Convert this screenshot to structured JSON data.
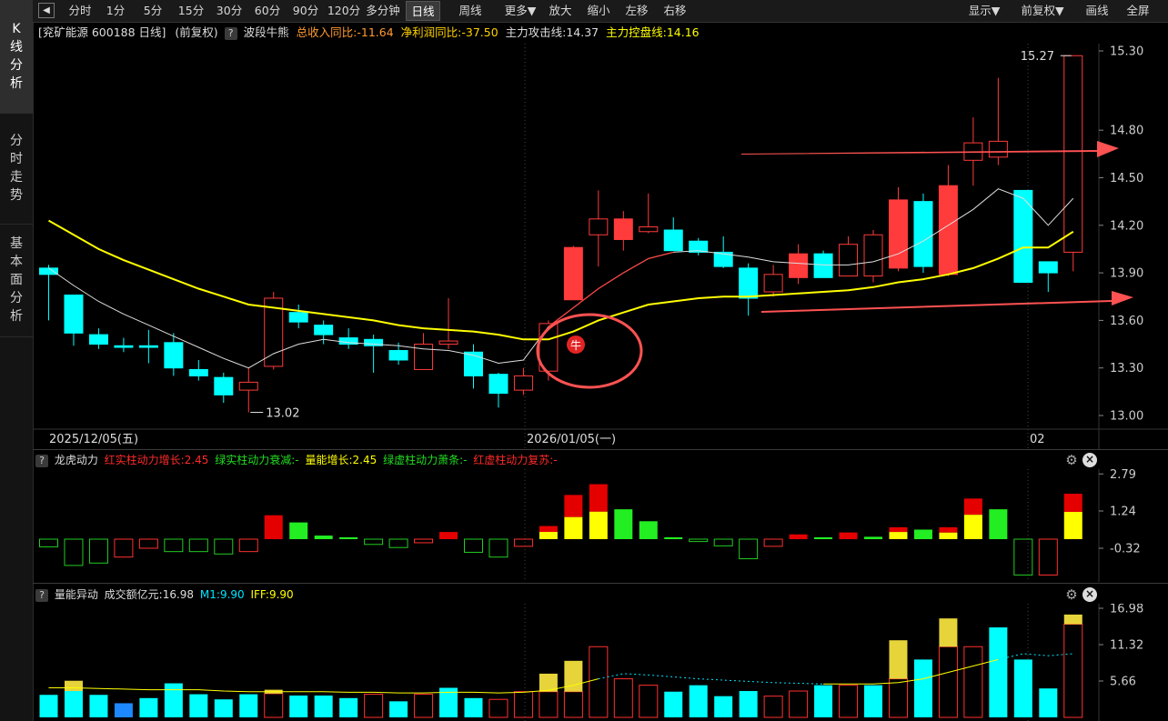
{
  "sidebar": {
    "tabs": [
      {
        "label": "K线分析",
        "active": true
      },
      {
        "label": "分时走势",
        "active": false
      },
      {
        "label": "基本面分析",
        "active": false
      }
    ]
  },
  "toolbar": {
    "back_icon": "triangle-left-icon",
    "left_items": [
      {
        "label": "分时",
        "active": false
      },
      {
        "label": "1分",
        "active": false
      },
      {
        "label": "5分",
        "active": false
      },
      {
        "label": "15分",
        "active": false
      },
      {
        "label": "30分",
        "active": false
      },
      {
        "label": "60分",
        "active": false
      },
      {
        "label": "90分",
        "active": false
      },
      {
        "label": "120分",
        "active": false
      },
      {
        "label": "多分钟",
        "active": false
      },
      {
        "label": "日线",
        "active": true
      },
      {
        "label": "周线",
        "active": false
      },
      {
        "label": "更多▼",
        "active": false
      },
      {
        "label": "放大",
        "active": false
      },
      {
        "label": "缩小",
        "active": false
      },
      {
        "label": "左移",
        "active": false
      },
      {
        "label": "右移",
        "active": false
      }
    ],
    "right_items": [
      {
        "label": "显示▼"
      },
      {
        "label": "前复权▼"
      },
      {
        "label": "画线"
      },
      {
        "label": "全屏"
      }
    ]
  },
  "main_chart": {
    "stock_title": "[兖矿能源 600188 日线]",
    "adjust": "(前复权)",
    "help": "?",
    "indicator_name": "波段牛熊",
    "revenue_yoy": "总收入同比:-11.64",
    "profit_yoy": "净利润同比:-37.50",
    "attack_line": "主力攻击线:14.37",
    "control_line": "主力控盘线:14.16",
    "y_ticks": [
      "15.30",
      "14.80",
      "14.50",
      "14.20",
      "13.90",
      "13.60",
      "13.30",
      "13.00"
    ],
    "x_labels": [
      "2025/12/05(五)",
      "2026/01/05(一)",
      "02"
    ],
    "max_label": "15.27",
    "min_label": "13.02",
    "bull_marker": "牛",
    "colors": {
      "up": "#ff3b3b",
      "down": "#00ffff",
      "ma_yellow": "#ffff00",
      "ma_white": "#dddddd",
      "annotation": "#ff5252"
    }
  },
  "indicator1": {
    "help": "?",
    "name": "龙虎动力",
    "red_solid": "红实柱动力增长:2.45",
    "green_solid": "绿实柱动力衰减:-",
    "volume_growth": "量能增长:2.45",
    "green_hollow": "绿虚柱动力萧条:-",
    "red_hollow": "红虚柱动力复苏:-",
    "y_ticks": [
      "2.79",
      "1.24",
      "-0.32"
    ],
    "gear_icon": "gear-icon",
    "close_icon": "close-icon"
  },
  "indicator2": {
    "help": "?",
    "name": "量能异动",
    "turnover": "成交额亿元:16.98",
    "m1": "M1:9.90",
    "iff": "IFF:9.90",
    "y_ticks": [
      "16.98",
      "11.32",
      "5.66"
    ],
    "gear_icon": "gear-icon",
    "close_icon": "close-icon"
  },
  "chart_data": [
    {
      "type": "candlestick",
      "title": "兖矿能源 600188 日线",
      "ylim": [
        13.0,
        15.3
      ],
      "candles": [
        {
          "o": 13.93,
          "c": 13.89,
          "h": 13.95,
          "l": 13.6
        },
        {
          "o": 13.76,
          "c": 13.52,
          "h": 13.76,
          "l": 13.44
        },
        {
          "o": 13.51,
          "c": 13.45,
          "h": 13.55,
          "l": 13.42
        },
        {
          "o": 13.44,
          "c": 13.43,
          "h": 13.49,
          "l": 13.4
        },
        {
          "o": 13.44,
          "c": 13.43,
          "h": 13.54,
          "l": 13.33
        },
        {
          "o": 13.46,
          "c": 13.3,
          "h": 13.52,
          "l": 13.25
        },
        {
          "o": 13.29,
          "c": 13.25,
          "h": 13.35,
          "l": 13.22
        },
        {
          "o": 13.24,
          "c": 13.13,
          "h": 13.27,
          "l": 13.08
        },
        {
          "o": 13.16,
          "c": 13.21,
          "h": 13.3,
          "l": 13.02
        },
        {
          "o": 13.31,
          "c": 13.74,
          "h": 13.78,
          "l": 13.29
        },
        {
          "o": 13.65,
          "c": 13.59,
          "h": 13.7,
          "l": 13.55
        },
        {
          "o": 13.57,
          "c": 13.51,
          "h": 13.6,
          "l": 13.45
        },
        {
          "o": 13.49,
          "c": 13.45,
          "h": 13.55,
          "l": 13.42
        },
        {
          "o": 13.48,
          "c": 13.44,
          "h": 13.51,
          "l": 13.27
        },
        {
          "o": 13.41,
          "c": 13.35,
          "h": 13.46,
          "l": 13.32
        },
        {
          "o": 13.29,
          "c": 13.45,
          "h": 13.52,
          "l": 13.29
        },
        {
          "o": 13.45,
          "c": 13.47,
          "h": 13.74,
          "l": 13.42
        },
        {
          "o": 13.4,
          "c": 13.25,
          "h": 13.45,
          "l": 13.17
        },
        {
          "o": 13.26,
          "c": 13.14,
          "h": 13.27,
          "l": 13.05
        },
        {
          "o": 13.16,
          "c": 13.25,
          "h": 13.3,
          "l": 13.13
        },
        {
          "o": 13.28,
          "c": 13.58,
          "h": 13.6,
          "l": 13.22
        },
        {
          "o": 13.73,
          "c": 14.06,
          "h": 14.07,
          "l": 13.73
        },
        {
          "o": 14.14,
          "c": 14.24,
          "h": 14.42,
          "l": 13.94
        },
        {
          "o": 14.11,
          "c": 14.24,
          "h": 14.29,
          "l": 14.04
        },
        {
          "o": 14.16,
          "c": 14.19,
          "h": 14.4,
          "l": 14.15
        },
        {
          "o": 14.17,
          "c": 14.04,
          "h": 14.25,
          "l": 14.04
        },
        {
          "o": 14.1,
          "c": 14.03,
          "h": 14.12,
          "l": 14.01
        },
        {
          "o": 14.03,
          "c": 13.94,
          "h": 14.13,
          "l": 13.93
        },
        {
          "o": 13.93,
          "c": 13.74,
          "h": 13.96,
          "l": 13.63
        },
        {
          "o": 13.78,
          "c": 13.89,
          "h": 13.95,
          "l": 13.75
        },
        {
          "o": 13.87,
          "c": 14.02,
          "h": 14.08,
          "l": 13.83
        },
        {
          "o": 14.02,
          "c": 13.87,
          "h": 14.04,
          "l": 13.87
        },
        {
          "o": 13.88,
          "c": 14.08,
          "h": 14.13,
          "l": 13.88
        },
        {
          "o": 13.88,
          "c": 14.14,
          "h": 14.17,
          "l": 13.84
        },
        {
          "o": 13.93,
          "c": 14.36,
          "h": 14.44,
          "l": 13.91
        },
        {
          "o": 14.35,
          "c": 13.94,
          "h": 14.4,
          "l": 13.9
        },
        {
          "o": 13.89,
          "c": 14.45,
          "h": 14.58,
          "l": 13.88
        },
        {
          "o": 14.61,
          "c": 14.72,
          "h": 14.88,
          "l": 14.45
        },
        {
          "o": 14.63,
          "c": 14.73,
          "h": 15.13,
          "l": 14.58
        },
        {
          "o": 14.42,
          "c": 13.84,
          "h": 14.42,
          "l": 13.84
        },
        {
          "o": 13.97,
          "c": 13.9,
          "h": 13.97,
          "l": 13.78
        },
        {
          "o": 14.03,
          "c": 15.27,
          "h": 15.27,
          "l": 13.91
        }
      ],
      "ma_white": [
        13.93,
        13.82,
        13.72,
        13.64,
        13.57,
        13.5,
        13.43,
        13.36,
        13.3,
        13.39,
        13.45,
        13.48,
        13.46,
        13.45,
        13.44,
        13.42,
        13.41,
        13.38,
        13.33,
        13.35,
        13.56,
        13.68,
        13.8,
        13.9,
        13.99,
        14.03,
        14.04,
        14.02,
        14.0,
        13.97,
        13.96,
        13.95,
        13.95,
        13.97,
        14.02,
        14.1,
        14.2,
        14.3,
        14.43,
        14.37,
        14.2,
        14.37
      ],
      "ma_yellow": [
        14.23,
        14.14,
        14.05,
        13.98,
        13.92,
        13.86,
        13.8,
        13.75,
        13.7,
        13.68,
        13.66,
        13.64,
        13.62,
        13.6,
        13.57,
        13.55,
        13.54,
        13.53,
        13.51,
        13.48,
        13.48,
        13.53,
        13.6,
        13.65,
        13.7,
        13.72,
        13.74,
        13.75,
        13.75,
        13.76,
        13.77,
        13.78,
        13.79,
        13.81,
        13.84,
        13.86,
        13.89,
        13.93,
        13.99,
        14.06,
        14.06,
        14.16
      ]
    },
    {
      "type": "bar",
      "title": "龙虎动力",
      "ylim": [
        -0.9,
        3.2
      ],
      "values": [
        -0.32,
        -1.1,
        -1.0,
        -0.75,
        -0.38,
        -0.52,
        -0.52,
        -0.62,
        -0.52,
        1.0,
        0.7,
        0.15,
        0.08,
        -0.22,
        -0.35,
        -0.15,
        0.3,
        -0.55,
        -0.75,
        -0.3,
        0.55,
        1.85,
        2.3,
        1.25,
        0.75,
        0.08,
        -0.1,
        -0.28,
        -0.82,
        -0.3,
        0.2,
        0.08,
        0.28,
        0.1,
        0.5,
        0.4,
        0.5,
        1.7,
        1.25,
        -1.5,
        -1.5,
        1.9
      ],
      "styles": [
        "hg",
        "hg",
        "hg",
        "hr",
        "hr",
        "hg",
        "hg",
        "hg",
        "hr",
        "sr",
        "sg",
        "sg",
        "sg",
        "hg",
        "hg",
        "hr",
        "sr",
        "hg",
        "hg",
        "hr",
        "sry",
        "sry",
        "sry",
        "sg",
        "sg",
        "sg",
        "hg",
        "hg",
        "hg",
        "hr",
        "sr",
        "sg",
        "sr",
        "sg",
        "sry",
        "sg",
        "sry",
        "sry",
        "sg",
        "hg",
        "hr",
        "sry"
      ],
      "yellow_fraction": [
        0,
        0,
        0,
        0,
        0,
        0,
        0,
        0,
        0,
        0,
        0,
        0,
        0,
        0,
        0,
        0,
        0,
        0,
        0,
        0,
        0.55,
        0.5,
        0.5,
        0,
        0,
        0,
        0,
        0,
        0,
        0,
        0,
        0,
        0,
        0,
        0.6,
        0,
        0.55,
        0.6,
        0,
        0,
        0,
        0.6
      ]
    },
    {
      "type": "bar",
      "title": "量能异动",
      "ylim": [
        0,
        16.98
      ],
      "values": [
        3.5,
        4.1,
        3.5,
        2.2,
        3.0,
        5.3,
        3.6,
        2.8,
        3.6,
        3.7,
        3.4,
        3.4,
        3.0,
        3.6,
        2.5,
        3.6,
        4.6,
        3.0,
        2.8,
        4.0,
        4.0,
        4.0,
        11.0,
        6.0,
        5.0,
        4.0,
        5.0,
        3.3,
        4.1,
        3.3,
        4.1,
        5.0,
        5.0,
        5.0,
        6.0,
        9.0,
        11.0,
        11.0,
        14.0,
        9.0,
        4.5,
        14.5
      ],
      "extra_yellow": [
        0,
        1.6,
        0,
        0,
        0,
        0,
        0,
        0,
        0,
        0.6,
        0,
        0,
        0,
        0,
        0,
        0,
        0,
        0,
        0,
        0,
        2.8,
        4.8,
        0,
        0,
        0,
        0,
        0,
        0,
        0,
        0,
        0,
        0,
        0,
        0,
        6.0,
        0,
        4.4,
        0,
        0,
        0,
        0,
        1.5
      ],
      "styles": [
        "c",
        "c",
        "c",
        "b",
        "c",
        "c",
        "c",
        "c",
        "c",
        "r",
        "c",
        "c",
        "c",
        "r",
        "c",
        "r",
        "c",
        "c",
        "r",
        "r",
        "r",
        "r",
        "r",
        "r",
        "r",
        "c",
        "c",
        "c",
        "c",
        "r",
        "r",
        "c",
        "r",
        "c",
        "r",
        "c",
        "r",
        "r",
        "c",
        "c",
        "c",
        "r"
      ],
      "m1": [
        4.6,
        4.6,
        4.5,
        4.4,
        4.3,
        4.3,
        4.3,
        4.1,
        4.0,
        4.0,
        4.0,
        4.0,
        3.9,
        3.9,
        3.8,
        3.8,
        3.9,
        3.9,
        3.8,
        3.9,
        4.2,
        5.0,
        6.0,
        6.8,
        6.6,
        6.3,
        6.0,
        5.8,
        5.6,
        5.4,
        5.3,
        5.2,
        5.2,
        5.2,
        5.4,
        6.0,
        7.0,
        8.0,
        9.0,
        9.9,
        9.6,
        9.9
      ]
    }
  ]
}
